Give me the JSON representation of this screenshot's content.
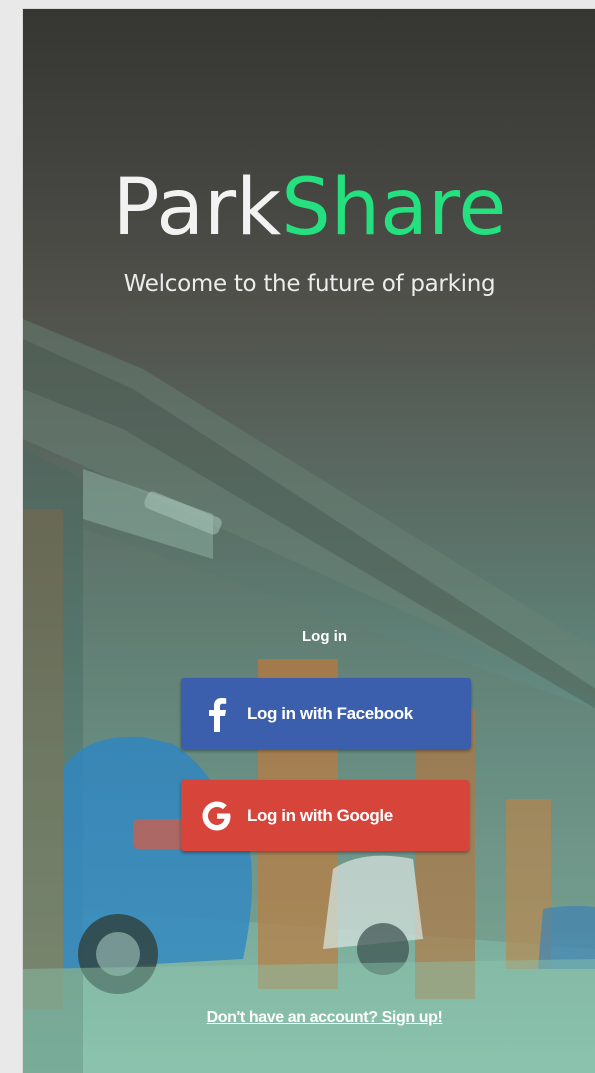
{
  "brand": {
    "name_part1": "Park",
    "name_part2": "Share",
    "tagline": "Welcome to the future of parking"
  },
  "login": {
    "heading": "Log in",
    "facebook_button": "Log in with Facebook",
    "google_button": "Log in with Google",
    "signup_link": "Don't have an account? Sign up!"
  },
  "icons": {
    "facebook": "facebook-f-icon",
    "google": "google-g-icon"
  },
  "colors": {
    "brand_accent": "#25e07e",
    "facebook_blue": "#3b5fad",
    "google_red": "#d7443a"
  }
}
